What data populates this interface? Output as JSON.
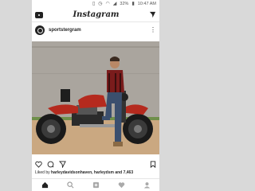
{
  "status": {
    "battery": "32%",
    "time": "10:47 AM"
  },
  "app": {
    "title": "Instagram"
  },
  "post": {
    "username": "sportstergram",
    "liked_by": "Liked by ",
    "liked_names": "harleydavidsonhaven, harleydsm and 7,463",
    "alt": "motorcycle rider photo"
  },
  "icons": {
    "status": [
      "vibrate-icon",
      "alarm-icon",
      "wifi-icon",
      "signal-icon",
      "battery-icon"
    ],
    "top": [
      "camera-icon",
      "direct-send-icon"
    ],
    "actions": [
      "heart-icon",
      "comment-icon",
      "share-icon",
      "bookmark-icon"
    ],
    "nav": [
      "home-icon",
      "search-icon",
      "add-post-icon",
      "activity-icon",
      "profile-icon"
    ]
  },
  "colors": {
    "accent": "#c0392b",
    "bike_red": "#b52a1e",
    "text": "#262626"
  }
}
